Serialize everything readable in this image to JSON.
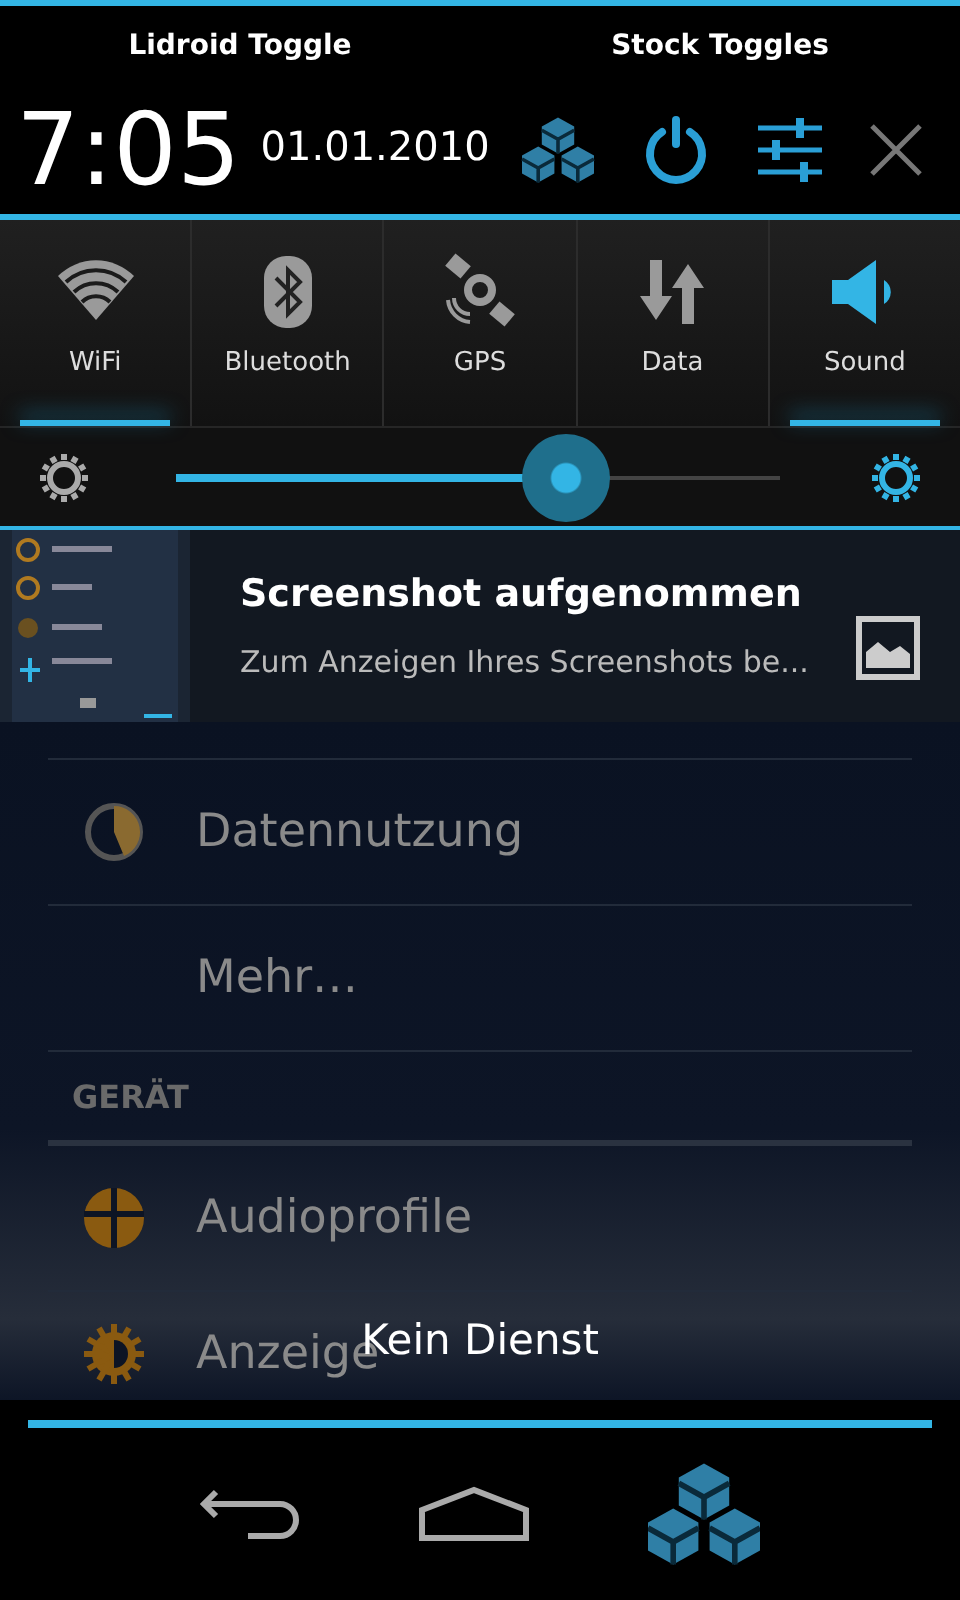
{
  "panel_tabs": [
    {
      "label": "Lidroid Toggle"
    },
    {
      "label": "Stock Toggles"
    }
  ],
  "clock": {
    "time": "7:05",
    "date": "01.01.2010"
  },
  "toggles": [
    {
      "kind": "wifi",
      "label": "WiFi",
      "on": true,
      "icon_lit": false
    },
    {
      "kind": "bluetooth",
      "label": "Bluetooth",
      "on": false,
      "icon_lit": false
    },
    {
      "kind": "gps",
      "label": "GPS",
      "on": false,
      "icon_lit": false
    },
    {
      "kind": "data",
      "label": "Data",
      "on": false,
      "icon_lit": false
    },
    {
      "kind": "sound",
      "label": "Sound",
      "on": true,
      "icon_lit": true
    }
  ],
  "brightness": {
    "level": 0.645
  },
  "notification": {
    "title": "Screenshot aufgenommen",
    "text": "Zum Anzeigen Ihres Screenshots be..."
  },
  "settings": [
    {
      "kind": "usage",
      "label": "Datennutzung"
    },
    {
      "kind": "plain",
      "label": "Mehr…"
    },
    {
      "kind": "header",
      "label": "GERÄT"
    },
    {
      "kind": "audio",
      "label": "Audioprofile"
    },
    {
      "kind": "display",
      "label": "Anzeige"
    }
  ],
  "toast": "Kein Dienst"
}
